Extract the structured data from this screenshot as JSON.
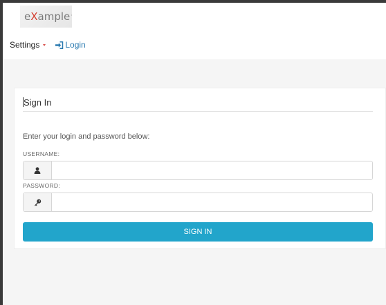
{
  "logo": {
    "prefix": "e",
    "accent": "X",
    "suffix": "ample",
    "mark": "™"
  },
  "nav": {
    "settings_label": "Settings",
    "login_label": "Login"
  },
  "panel": {
    "title": "Sign In",
    "intro": "Enter your login and password below:",
    "username_label": "USERNAME:",
    "username_value": "",
    "password_label": "PASSWORD:",
    "password_value": "",
    "submit_label": "SIGN IN"
  },
  "icons": {
    "login": "sign-in-icon",
    "username": "user-icon",
    "password": "key-icon",
    "settings_caret": "caret-down-icon"
  },
  "colors": {
    "primary": "#22a5cb",
    "link": "#2a7ab0",
    "caret": "#d9534f",
    "logo_accent": "#d33b2c",
    "background": "#f5f5f5"
  }
}
